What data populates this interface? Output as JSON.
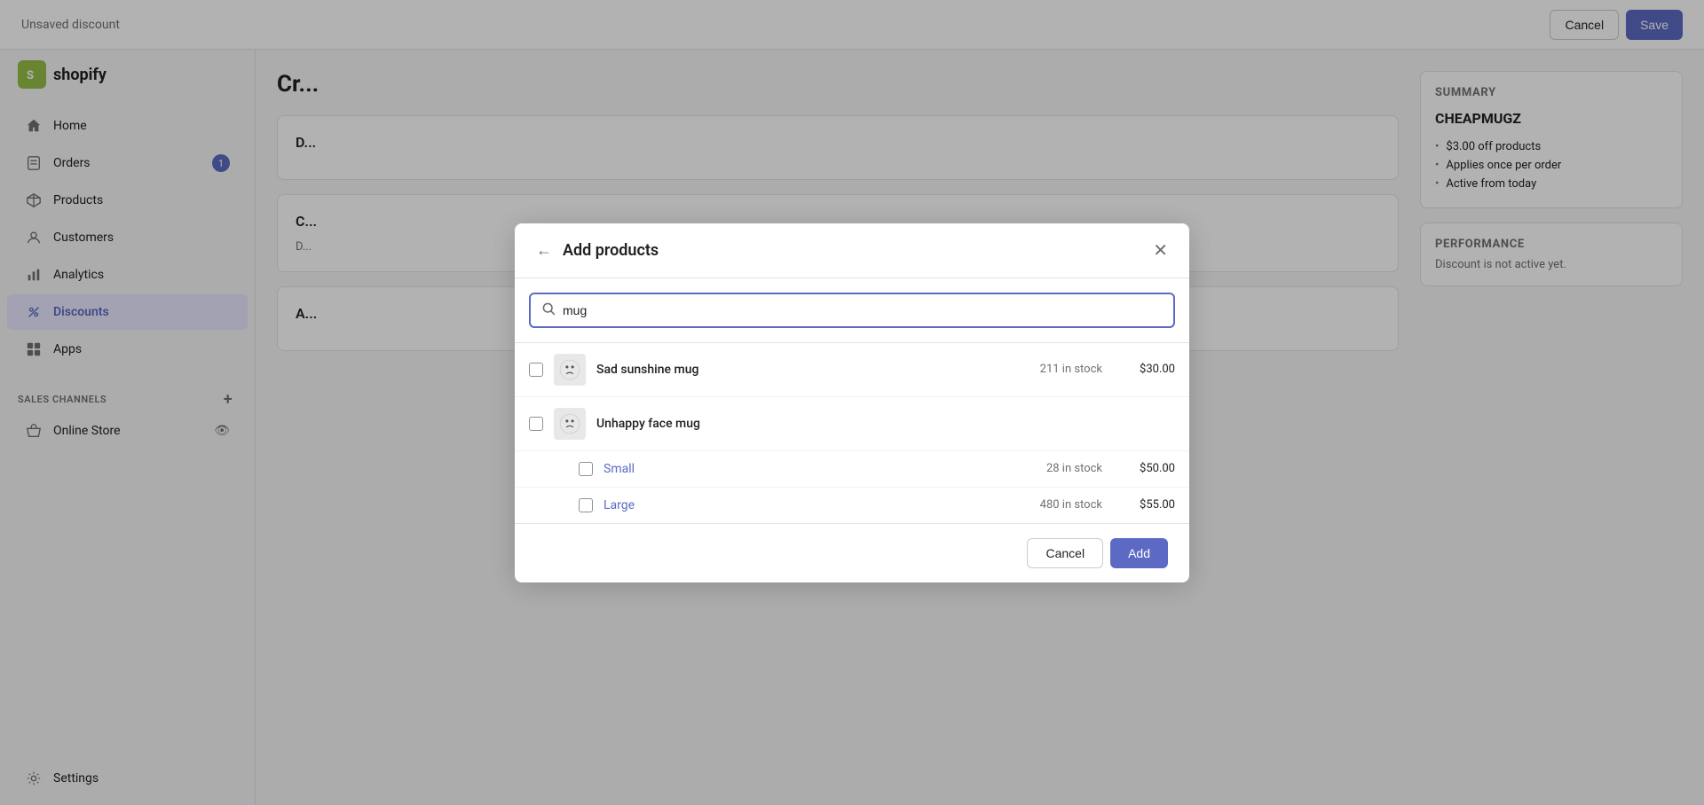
{
  "topbar": {
    "title": "Unsaved discount",
    "cancel_label": "Cancel",
    "save_label": "Save"
  },
  "sidebar": {
    "logo_text": "shopify",
    "logo_initial": "S",
    "nav_items": [
      {
        "id": "home",
        "label": "Home",
        "icon": "home-icon",
        "badge": null,
        "active": false
      },
      {
        "id": "orders",
        "label": "Orders",
        "icon": "orders-icon",
        "badge": "1",
        "active": false
      },
      {
        "id": "products",
        "label": "Products",
        "icon": "products-icon",
        "badge": null,
        "active": false
      },
      {
        "id": "customers",
        "label": "Customers",
        "icon": "customers-icon",
        "badge": null,
        "active": false
      },
      {
        "id": "analytics",
        "label": "Analytics",
        "icon": "analytics-icon",
        "badge": null,
        "active": false
      },
      {
        "id": "discounts",
        "label": "Discounts",
        "icon": "discounts-icon",
        "badge": null,
        "active": true
      },
      {
        "id": "apps",
        "label": "Apps",
        "icon": "apps-icon",
        "badge": null,
        "active": false
      }
    ],
    "sales_channels_label": "SALES CHANNELS",
    "sales_channels": [
      {
        "id": "online-store",
        "label": "Online Store",
        "icon": "store-icon"
      }
    ],
    "settings_label": "Settings"
  },
  "page": {
    "title": "Cr..."
  },
  "summary": {
    "title": "Summary",
    "code": "CHEAPMUGZ",
    "bullets": [
      "$3.00 off products",
      "Applies once per order",
      "Active from today"
    ],
    "performance_title": "PERFORMANCE",
    "performance_text": "Discount is not active yet."
  },
  "modal": {
    "title": "Add products",
    "search_placeholder": "mug",
    "search_value": "mug",
    "products": [
      {
        "id": "sad-sunshine-mug",
        "name": "Sad sunshine mug",
        "stock": "211 in stock",
        "price": "$30.00",
        "has_thumb": true,
        "thumb_type": "sad",
        "variants": []
      },
      {
        "id": "unhappy-face-mug",
        "name": "Unhappy face mug",
        "stock": "",
        "price": "",
        "has_thumb": true,
        "thumb_type": "unhappy",
        "variants": [
          {
            "id": "small",
            "name": "Small",
            "stock": "28 in stock",
            "price": "$50.00"
          },
          {
            "id": "large",
            "name": "Large",
            "stock": "480 in stock",
            "price": "$55.00"
          }
        ]
      }
    ],
    "cancel_label": "Cancel",
    "add_label": "Add"
  }
}
